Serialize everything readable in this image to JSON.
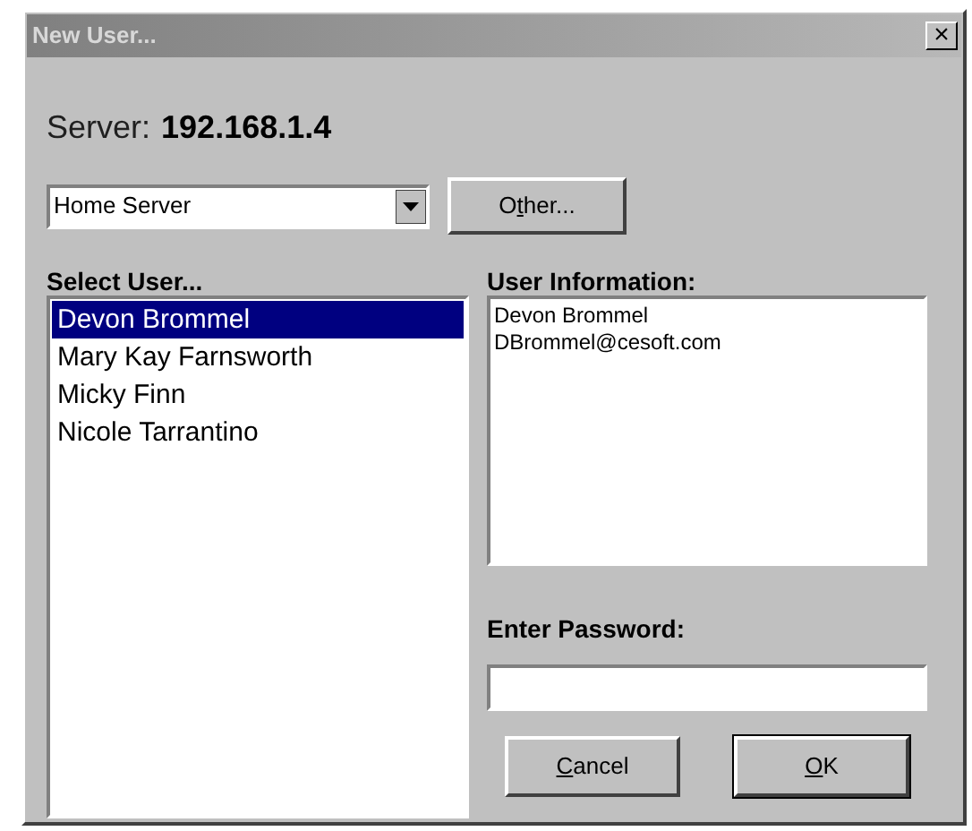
{
  "window": {
    "title": "New User...",
    "close": "×"
  },
  "server": {
    "label": "Server:",
    "value": "192.168.1.4"
  },
  "server_select": {
    "value": "Home Server"
  },
  "other_button": {
    "before": "O",
    "accelerator": "t",
    "after": "her..."
  },
  "users": {
    "label": "Select User...",
    "items": [
      {
        "name": "Devon Brommel",
        "selected": true
      },
      {
        "name": "Mary Kay Farnsworth",
        "selected": false
      },
      {
        "name": "Micky Finn",
        "selected": false
      },
      {
        "name": "Nicole Tarrantino",
        "selected": false
      }
    ]
  },
  "user_information": {
    "label": "User Information:",
    "lines": [
      "Devon Brommel",
      "DBrommel@cesoft.com"
    ]
  },
  "password": {
    "label": "Enter Password:"
  },
  "buttons": [
    {
      "accelerator": "C",
      "after": "ancel",
      "default": false
    },
    {
      "accelerator": "O",
      "after": "K",
      "default": true
    }
  ]
}
